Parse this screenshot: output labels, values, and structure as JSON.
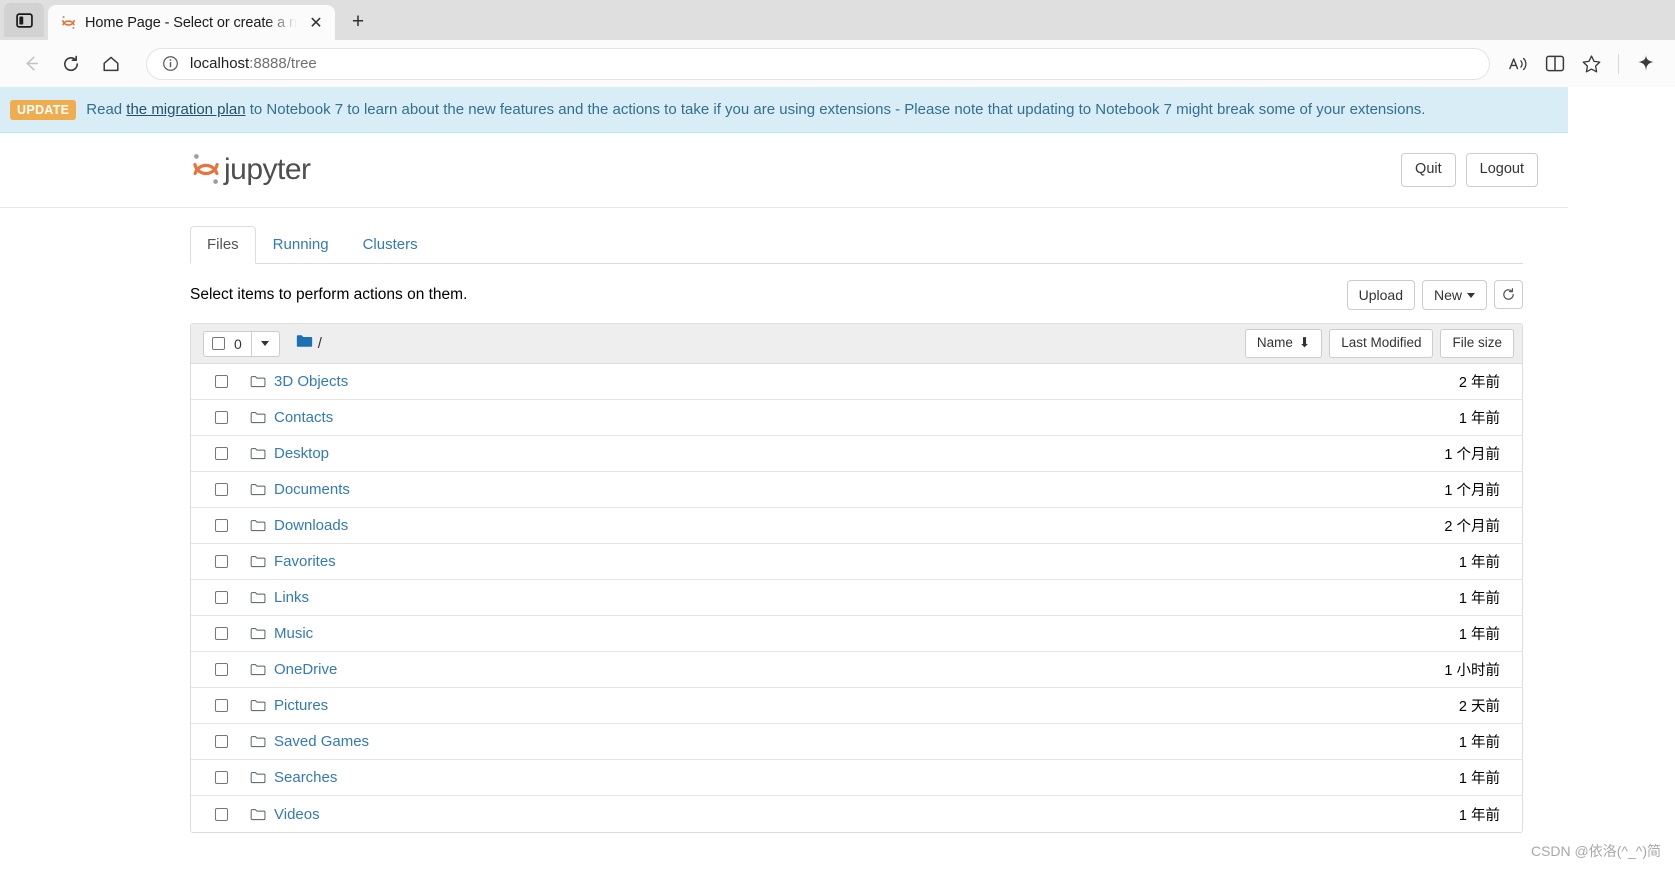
{
  "browser": {
    "tab": {
      "title": "Home Page - Select or create a n",
      "favicon": "jupyter-logo-icon",
      "close_label": "✕",
      "newtab_label": "+"
    },
    "nav": {
      "back": "←",
      "reload": "⟳",
      "home": "⌂"
    },
    "address": {
      "info_icon": "info-circle-icon",
      "url_host": "localhost",
      "url_path": ":8888/tree"
    },
    "right_icons": [
      {
        "name": "read-aloud-icon",
        "glyph": "Aᴺ"
      },
      {
        "name": "split-screen-icon",
        "glyph": "◫"
      },
      {
        "name": "favorite-star-icon",
        "glyph": "☆"
      },
      {
        "name": "collections-icon",
        "glyph": "✿"
      }
    ]
  },
  "alert": {
    "badge": "UPDATE",
    "text_before": "Read",
    "link": "the migration plan",
    "text_after": "to Notebook 7 to learn about the new features and the actions to take if you are using extensions - Please note that updating to Notebook 7 might break some of your extensions."
  },
  "header": {
    "logo_text": "jupyter",
    "quit_label": "Quit",
    "logout_label": "Logout"
  },
  "tabs": [
    {
      "label": "Files",
      "active": true
    },
    {
      "label": "Running",
      "active": false
    },
    {
      "label": "Clusters",
      "active": false
    }
  ],
  "toolbar": {
    "hint": "Select items to perform actions on them.",
    "upload_label": "Upload",
    "new_label": "New",
    "refresh_icon": "refresh-icon"
  },
  "filelist": {
    "select_count": "0",
    "breadcrumb_root_icon": "folder-icon",
    "breadcrumb_sep": "/",
    "sort": {
      "name_label": "Name",
      "name_arrow": "⬇",
      "modified_label": "Last Modified",
      "size_label": "File size"
    },
    "rows": [
      {
        "name": "3D Objects",
        "modified": "2 年前"
      },
      {
        "name": "Contacts",
        "modified": "1 年前"
      },
      {
        "name": "Desktop",
        "modified": "1 个月前"
      },
      {
        "name": "Documents",
        "modified": "1 个月前"
      },
      {
        "name": "Downloads",
        "modified": "2 个月前"
      },
      {
        "name": "Favorites",
        "modified": "1 年前"
      },
      {
        "name": "Links",
        "modified": "1 年前"
      },
      {
        "name": "Music",
        "modified": "1 年前"
      },
      {
        "name": "OneDrive",
        "modified": "1 小时前"
      },
      {
        "name": "Pictures",
        "modified": "2 天前"
      },
      {
        "name": "Saved Games",
        "modified": "1 年前"
      },
      {
        "name": "Searches",
        "modified": "1 年前"
      },
      {
        "name": "Videos",
        "modified": "1 年前"
      }
    ]
  },
  "watermark": "CSDN @依洛(^_^)简",
  "colors": {
    "link": "#337ab7",
    "alert_bg": "#d9edf7",
    "alert_text": "#31708f",
    "badge": "#f0ad4e",
    "jupyter_orange": "#e8743b",
    "folder_blue": "#1a6fb5"
  }
}
